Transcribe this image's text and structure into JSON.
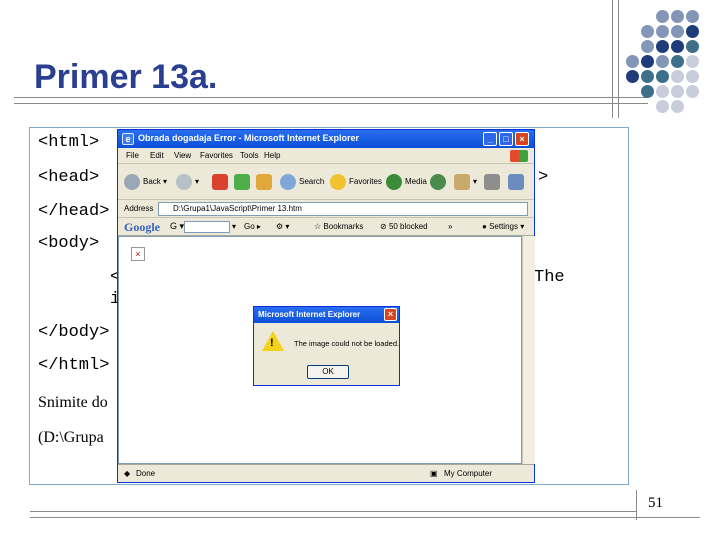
{
  "slide": {
    "title": "Primer 13a.",
    "page_number": "51"
  },
  "code_lines": [
    "<html>",
    "<head>",
    "</head>",
    "<body>",
    "<",
    "i",
    "</body>",
    "</html>"
  ],
  "code_tail": {
    "head_tail": ">",
    "line5_tail": "The"
  },
  "notes": {
    "line1": "Snimite do",
    "line2": "(D:\\Grupa"
  },
  "ie_window": {
    "title": "Obrada dogadaja Error - Microsoft Internet Explorer",
    "menu": [
      "File",
      "Edit",
      "View",
      "Favorites",
      "Tools",
      "Help"
    ],
    "toolbar": {
      "back": "Back",
      "search": "Search",
      "favorites": "Favorites",
      "media": "Media"
    },
    "address_label": "Address",
    "address_value": "D:\\Grupa1\\JavaScript\\Primer 13.htm",
    "google": {
      "logo": "Google",
      "go": "Go",
      "bookmarks": "Bookmarks",
      "blocked": "50 blocked",
      "settings": "Settings",
      "more": "»"
    },
    "status_left": "Done",
    "status_right": "My Computer"
  },
  "alert": {
    "title": "Microsoft Internet Explorer",
    "message": "The image could not be loaded.",
    "ok_label": "OK"
  },
  "colors": {
    "title": "#2a3f8f",
    "dots_dark": "#1f3c7a",
    "dots_mid": "#8496b8",
    "dots_teal": "#3e6f8a",
    "dots_light": "#c9cddb"
  }
}
